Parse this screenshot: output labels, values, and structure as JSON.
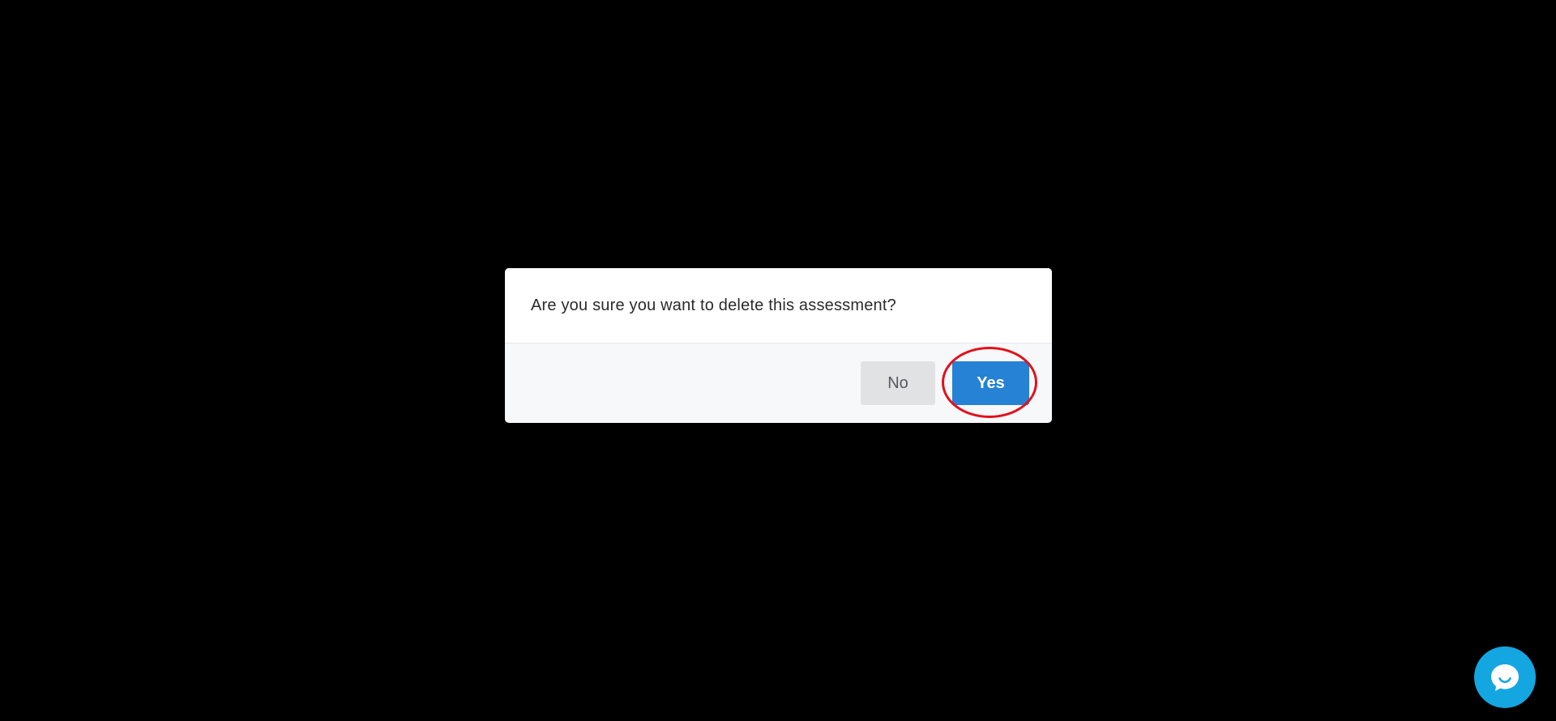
{
  "dialog": {
    "message": "Are you sure you want to delete this assessment?",
    "no_label": "No",
    "yes_label": "Yes"
  },
  "chat": {
    "icon": "chat-bubble-icon"
  },
  "colors": {
    "backdrop": "#000000",
    "primary": "#2582d4",
    "secondary_button": "#e1e2e4",
    "highlight": "#e3101a",
    "chat_launcher": "#14a6e0"
  }
}
